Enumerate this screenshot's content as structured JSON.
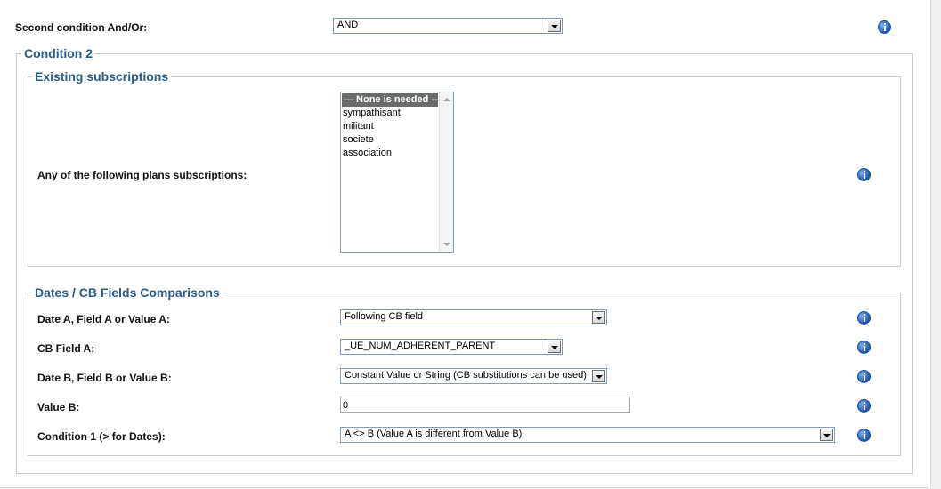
{
  "second_condition": {
    "label": "Second condition And/Or:",
    "value": "AND"
  },
  "condition2": {
    "legend": "Condition 2",
    "existing_subscriptions": {
      "legend": "Existing subscriptions",
      "label": "Any of the following plans subscriptions:",
      "options": [
        "--- None is needed ---",
        "sympathisant",
        "militant",
        "societe",
        "association"
      ],
      "selected_index": 0
    },
    "dates_comparisons": {
      "legend": "Dates / CB Fields Comparisons",
      "rows": [
        {
          "label": "Date A, Field A or Value A:",
          "value": "Following CB field"
        },
        {
          "label": "CB Field A:",
          "value": "_UE_NUM_ADHERENT_PARENT"
        },
        {
          "label": "Date B, Field B or Value B:",
          "value": "Constant Value or String (CB substitutions can be used)"
        },
        {
          "label": "Value B:",
          "value": "0"
        },
        {
          "label_prefix": "Condition ",
          "label_num": "1",
          "label_suffix": " (> for Dates):",
          "value": "A <> B (Value A is different from Value B)"
        }
      ]
    }
  },
  "icons": {
    "info": "info-icon",
    "dropdown": "chevron-down-icon"
  },
  "colors": {
    "legend": "#2a5c8a",
    "selected_option_bg": "#6b6b6b",
    "info_icon": "#1a56b8"
  }
}
